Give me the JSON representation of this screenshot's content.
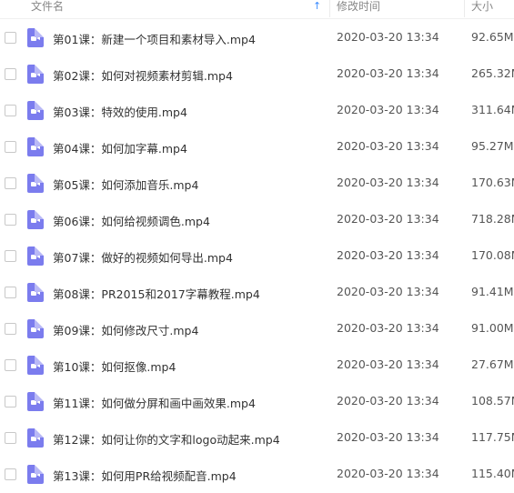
{
  "header": {
    "name_label": "文件名",
    "sort_icon": "↑",
    "mtime_label": "修改时间",
    "size_label": "大小"
  },
  "files": [
    {
      "name": "第01课：新建一个项目和素材导入.mp4",
      "mtime": "2020-03-20 13:34",
      "size": "92.65M"
    },
    {
      "name": "第02课：如何对视频素材剪辑.mp4",
      "mtime": "2020-03-20 13:34",
      "size": "265.32M"
    },
    {
      "name": "第03课：特效的使用.mp4",
      "mtime": "2020-03-20 13:34",
      "size": "311.64M"
    },
    {
      "name": "第04课：如何加字幕.mp4",
      "mtime": "2020-03-20 13:34",
      "size": "95.27M"
    },
    {
      "name": "第05课：如何添加音乐.mp4",
      "mtime": "2020-03-20 13:34",
      "size": "170.63M"
    },
    {
      "name": "第06课：如何给视频调色.mp4",
      "mtime": "2020-03-20 13:34",
      "size": "718.28M"
    },
    {
      "name": "第07课：做好的视频如何导出.mp4",
      "mtime": "2020-03-20 13:34",
      "size": "170.08M"
    },
    {
      "name": "第08课：PR2015和2017字幕教程.mp4",
      "mtime": "2020-03-20 13:34",
      "size": "91.41M"
    },
    {
      "name": "第09课：如何修改尺寸.mp4",
      "mtime": "2020-03-20 13:34",
      "size": "91.00M"
    },
    {
      "name": "第10课：如何抠像.mp4",
      "mtime": "2020-03-20 13:34",
      "size": "27.67M"
    },
    {
      "name": "第11课：如何做分屏和画中画效果.mp4",
      "mtime": "2020-03-20 13:34",
      "size": "108.57M"
    },
    {
      "name": "第12课：如何让你的文字和logo动起来.mp4",
      "mtime": "2020-03-20 13:34",
      "size": "117.75M"
    },
    {
      "name": "第13课：如何用PR给视频配音.mp4",
      "mtime": "2020-03-20 13:34",
      "size": "115.40M"
    }
  ],
  "file_icon": "video-file-icon",
  "colors": {
    "icon": "#7b7cee",
    "sort_arrow": "#3b8cff"
  }
}
